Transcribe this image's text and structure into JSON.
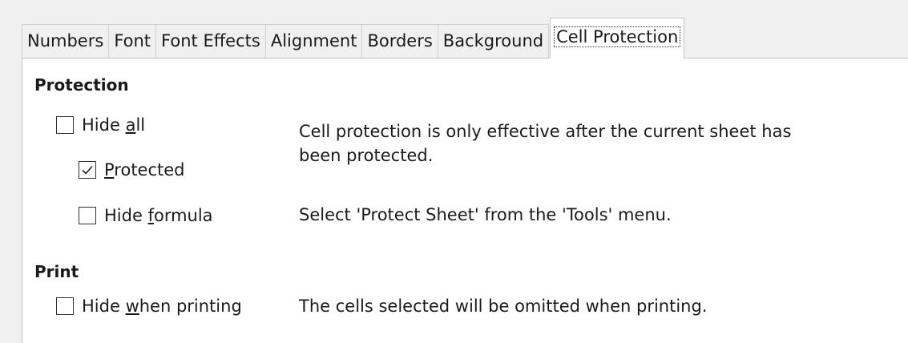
{
  "tabs": [
    {
      "label": "Numbers"
    },
    {
      "label": "Font"
    },
    {
      "label": "Font Effects"
    },
    {
      "label": "Alignment"
    },
    {
      "label": "Borders"
    },
    {
      "label": "Background"
    },
    {
      "label": "Cell Protection",
      "active": true
    }
  ],
  "protection": {
    "title": "Protection",
    "hide_all": {
      "pre": "Hid",
      "mid": "e ",
      "accel": "a",
      "post": "ll",
      "checked": false
    },
    "protected": {
      "pre": "",
      "accel": "P",
      "post": "rotected",
      "checked": true
    },
    "hide_formula": {
      "pre": "Hide ",
      "accel": "f",
      "post": "ormula",
      "checked": false
    },
    "info_line1": "Cell protection is only effective after the current sheet has",
    "info_line2": "been protected.",
    "info_tools": "Select 'Protect Sheet' from the 'Tools' menu."
  },
  "print": {
    "title": "Print",
    "hide_printing": {
      "pre": "Hide ",
      "accel": "w",
      "post": "hen printing",
      "checked": false
    },
    "info": "The cells selected will be omitted when printing."
  },
  "icons": {
    "checkbox_checked": "check-mark-icon"
  }
}
